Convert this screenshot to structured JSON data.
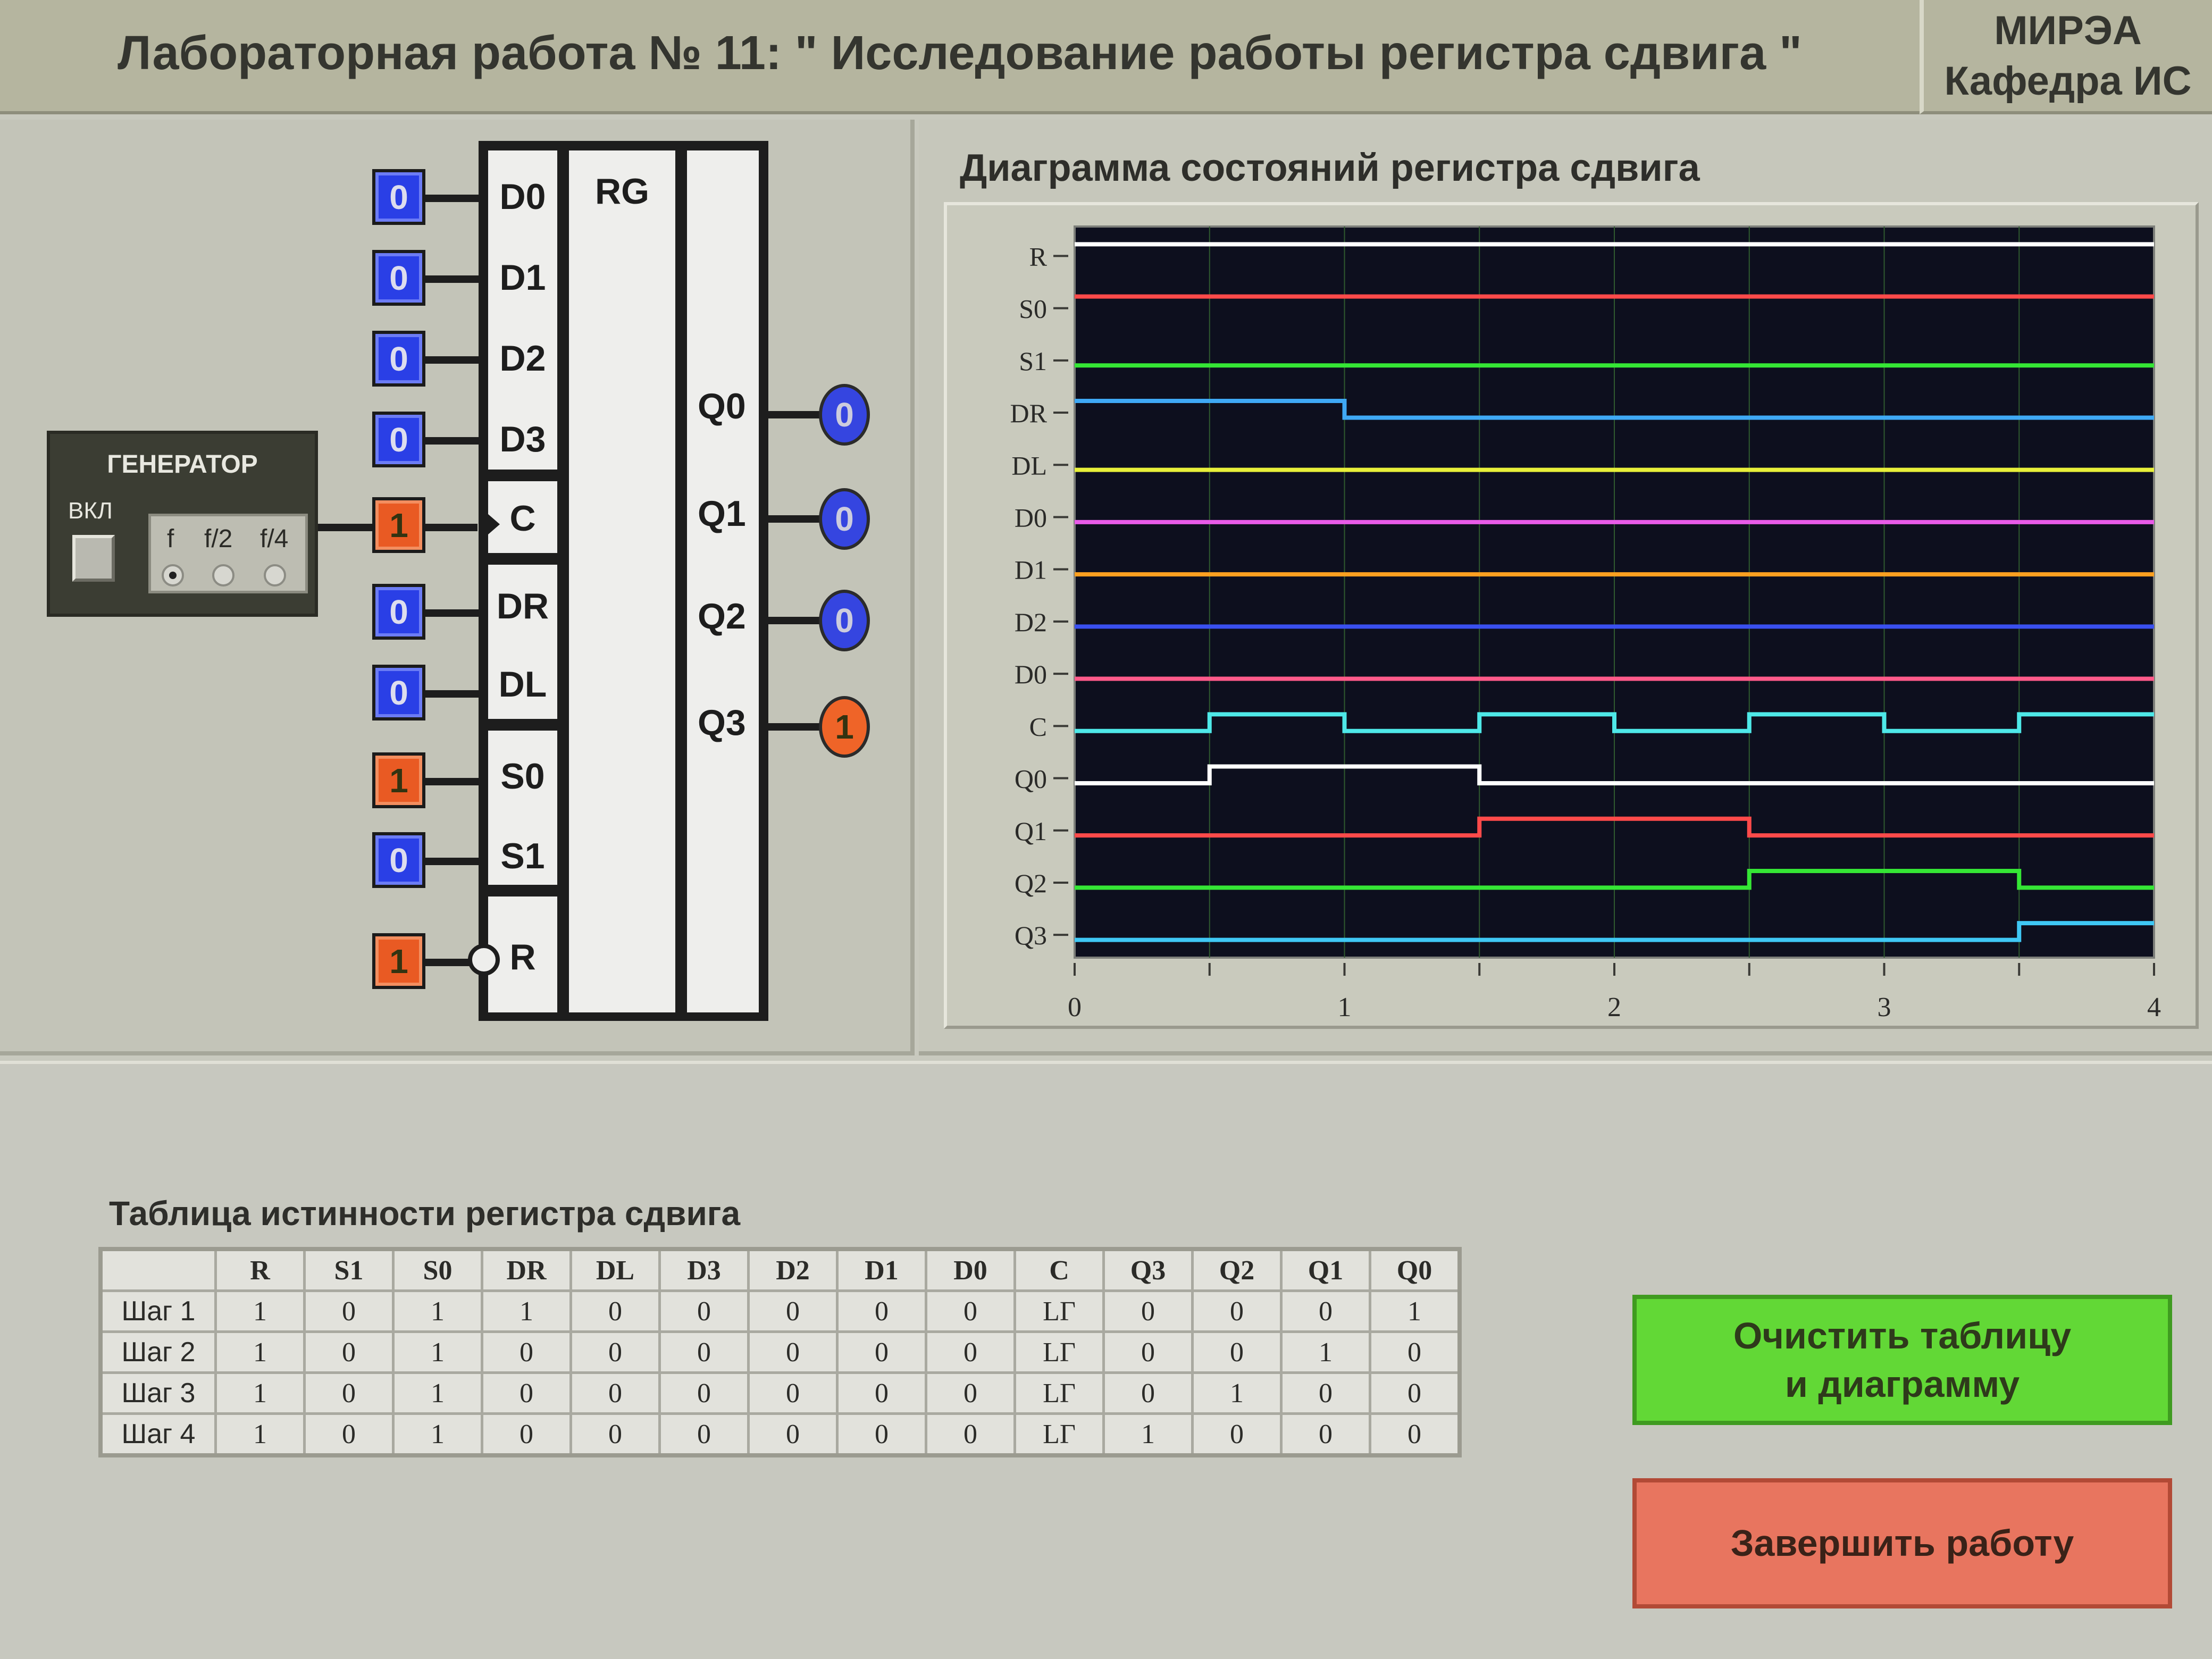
{
  "header": {
    "title": "Лабораторная работа № 11: \" Исследование работы регистра сдвига \"",
    "org_line1": "МИРЭА",
    "org_line2": "Кафедра ИС"
  },
  "generator": {
    "title": "ГЕНЕРАТОР",
    "on_label": "ВКЛ",
    "freq_options": [
      "f",
      "f/2",
      "f/4"
    ],
    "selected": "f"
  },
  "register": {
    "label": "RG",
    "inputs": [
      {
        "pin": "D0",
        "value": "0"
      },
      {
        "pin": "D1",
        "value": "0"
      },
      {
        "pin": "D2",
        "value": "0"
      },
      {
        "pin": "D3",
        "value": "0"
      },
      {
        "pin": "C",
        "value": "1"
      },
      {
        "pin": "DR",
        "value": "0"
      },
      {
        "pin": "DL",
        "value": "0"
      },
      {
        "pin": "S0",
        "value": "1"
      },
      {
        "pin": "S1",
        "value": "0"
      },
      {
        "pin": "R",
        "value": "1"
      }
    ],
    "outputs": [
      {
        "pin": "Q0",
        "value": "0"
      },
      {
        "pin": "Q1",
        "value": "0"
      },
      {
        "pin": "Q2",
        "value": "0"
      },
      {
        "pin": "Q3",
        "value": "1"
      }
    ]
  },
  "chart_title": "Диаграмма состояний регистра сдвига",
  "chart_data": {
    "type": "line",
    "title": "Диаграмма состояний регистра сдвига",
    "xlim": [
      0,
      4
    ],
    "x_ticks": [
      "0",
      "1",
      "2",
      "3",
      "4"
    ],
    "grid": true,
    "series": [
      {
        "name": "R",
        "color": "#ffffff",
        "steps": [
          [
            0,
            1
          ]
        ]
      },
      {
        "name": "S0",
        "color": "#ff4a4a",
        "steps": [
          [
            0,
            1
          ]
        ]
      },
      {
        "name": "S1",
        "color": "#35e635",
        "steps": [
          [
            0,
            0
          ]
        ]
      },
      {
        "name": "DR",
        "color": "#3fa9f5",
        "steps": [
          [
            0,
            1
          ],
          [
            1,
            0
          ]
        ]
      },
      {
        "name": "DL",
        "color": "#e8f03a",
        "steps": [
          [
            0,
            0
          ]
        ]
      },
      {
        "name": "D0",
        "color": "#e85be8",
        "steps": [
          [
            0,
            0
          ]
        ]
      },
      {
        "name": "D1",
        "color": "#ffa020",
        "steps": [
          [
            0,
            0
          ]
        ]
      },
      {
        "name": "D2",
        "color": "#3a50f0",
        "steps": [
          [
            0,
            0
          ]
        ]
      },
      {
        "name": "D0",
        "color": "#ff5a8a",
        "steps": [
          [
            0,
            0
          ]
        ]
      },
      {
        "name": "C",
        "color": "#4ee8e8",
        "steps": [
          [
            0,
            0
          ],
          [
            0.5,
            1
          ],
          [
            1,
            0
          ],
          [
            1.5,
            1
          ],
          [
            2,
            0
          ],
          [
            2.5,
            1
          ],
          [
            3,
            0
          ],
          [
            3.5,
            1
          ]
        ]
      },
      {
        "name": "Q0",
        "color": "#ffffff",
        "steps": [
          [
            0,
            0
          ],
          [
            0.5,
            1
          ],
          [
            1.5,
            0
          ]
        ]
      },
      {
        "name": "Q1",
        "color": "#ff4a4a",
        "steps": [
          [
            0,
            0
          ],
          [
            1.5,
            1
          ],
          [
            2.5,
            0
          ]
        ]
      },
      {
        "name": "Q2",
        "color": "#35e635",
        "steps": [
          [
            0,
            0
          ],
          [
            2.5,
            1
          ],
          [
            3.5,
            0
          ]
        ]
      },
      {
        "name": "Q3",
        "color": "#3fc8f5",
        "steps": [
          [
            0,
            0
          ],
          [
            3.5,
            1
          ]
        ]
      }
    ]
  },
  "table": {
    "title": "Таблица истинности регистра сдвига",
    "columns": [
      "R",
      "S1",
      "S0",
      "DR",
      "DL",
      "D3",
      "D2",
      "D1",
      "D0",
      "C",
      "Q3",
      "Q2",
      "Q1",
      "Q0"
    ],
    "rows": [
      {
        "label": "Шаг 1",
        "cells": [
          "1",
          "0",
          "1",
          "1",
          "0",
          "0",
          "0",
          "0",
          "0",
          "LΓ",
          "0",
          "0",
          "0",
          "1"
        ]
      },
      {
        "label": "Шаг 2",
        "cells": [
          "1",
          "0",
          "1",
          "0",
          "0",
          "0",
          "0",
          "0",
          "0",
          "LΓ",
          "0",
          "0",
          "1",
          "0"
        ]
      },
      {
        "label": "Шаг 3",
        "cells": [
          "1",
          "0",
          "1",
          "0",
          "0",
          "0",
          "0",
          "0",
          "0",
          "LΓ",
          "0",
          "1",
          "0",
          "0"
        ]
      },
      {
        "label": "Шаг 4",
        "cells": [
          "1",
          "0",
          "1",
          "0",
          "0",
          "0",
          "0",
          "0",
          "0",
          "LΓ",
          "1",
          "0",
          "0",
          "0"
        ]
      }
    ]
  },
  "buttons": {
    "clear": "Очистить таблицу\nи диаграмму",
    "finish": "Завершить работу"
  }
}
